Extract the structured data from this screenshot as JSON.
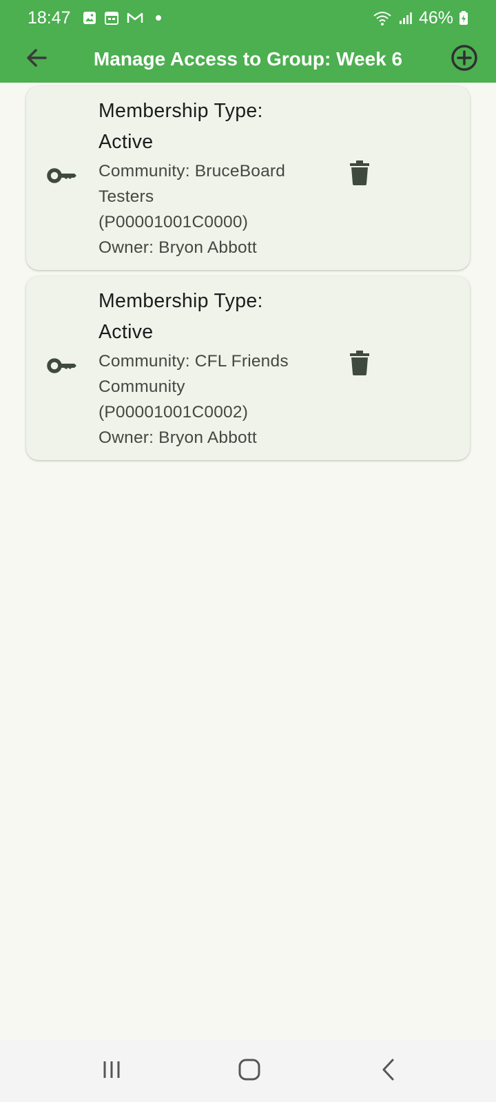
{
  "status_bar": {
    "time": "18:47",
    "battery": "46%",
    "icons": [
      "gallery-icon",
      "calendar-icon",
      "gmail-icon",
      "dot-icon",
      "wifi-icon",
      "signal-icon",
      "battery-icon"
    ]
  },
  "app_bar": {
    "title": "Manage Access to Group: Week 6",
    "back_icon": "arrow-left-icon",
    "add_icon": "add-circle-icon"
  },
  "memberships": [
    {
      "type_label": "Membership Type:",
      "type_value": "Active",
      "community_line1": "Community: BruceBoard",
      "community_line2": "Testers",
      "community_id": "(P00001001C0000)",
      "owner": "Owner: Bryon Abbott"
    },
    {
      "type_label": "Membership Type:",
      "type_value": "Active",
      "community_line1": "Community: CFL Friends",
      "community_line2": "Community",
      "community_id": "(P00001001C0002)",
      "owner": "Owner: Bryon Abbott"
    }
  ],
  "nav_bar": {
    "icons": [
      "recents-icon",
      "home-icon",
      "back-icon"
    ]
  },
  "colors": {
    "primary": "#4caf50",
    "background": "#f6f8f1",
    "card": "#f0f3ea",
    "icon": "#3f4a3d"
  }
}
